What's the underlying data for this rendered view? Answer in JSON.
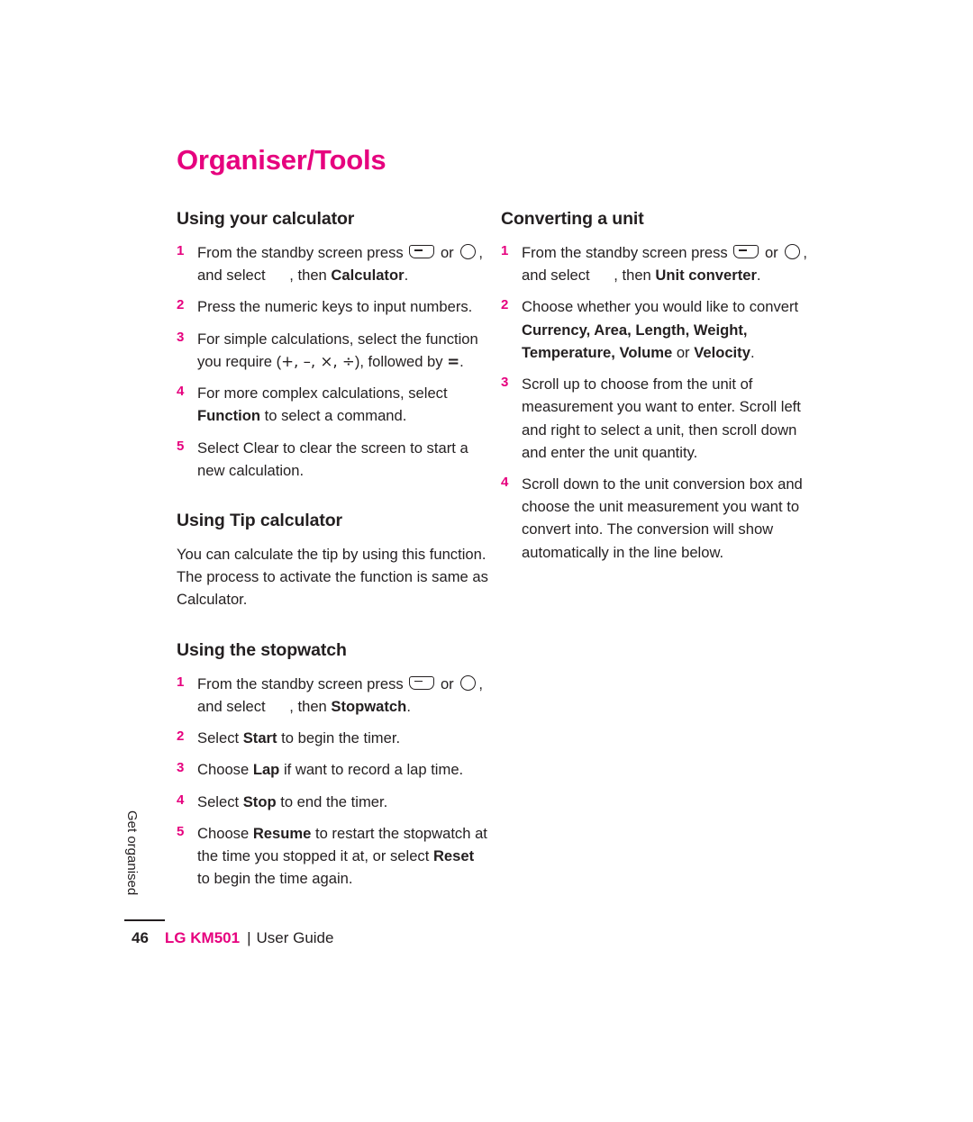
{
  "document": {
    "title": "Organiser/Tools",
    "side_tab": "Get organised",
    "footer": {
      "page_number": "46",
      "brand": "LG KM501",
      "separator": "|",
      "guide_label": "User Guide"
    }
  },
  "left_column": {
    "sections": [
      {
        "heading": "Using your calculator",
        "steps": [
          {
            "num": "1",
            "parts": [
              {
                "t": "text",
                "v": "From the standby screen press "
              },
              {
                "t": "icon",
                "v": "soft-key-icon"
              },
              {
                "t": "text",
                "v": " or "
              },
              {
                "t": "icon",
                "v": "circle-key-icon"
              },
              {
                "t": "text",
                "v": ", and select "
              },
              {
                "t": "gap",
                "v": ""
              },
              {
                "t": "text",
                "v": ", then "
              },
              {
                "t": "bold",
                "v": "Calculator"
              },
              {
                "t": "text",
                "v": "."
              }
            ]
          },
          {
            "num": "2",
            "parts": [
              {
                "t": "text",
                "v": "Press the numeric keys to input numbers."
              }
            ]
          },
          {
            "num": "3",
            "parts": [
              {
                "t": "text",
                "v": "For simple calculations, select the function you require ("
              },
              {
                "t": "math",
                "v": "+, –, ×, ÷"
              },
              {
                "t": "text",
                "v": "), followed by "
              },
              {
                "t": "boldmath",
                "v": "="
              },
              {
                "t": "text",
                "v": "."
              }
            ]
          },
          {
            "num": "4",
            "parts": [
              {
                "t": "text",
                "v": "For more complex calculations, select "
              },
              {
                "t": "bold",
                "v": "Function"
              },
              {
                "t": "text",
                "v": " to select a command."
              }
            ]
          },
          {
            "num": "5",
            "parts": [
              {
                "t": "text",
                "v": "Select Clear to clear the screen to start a new calculation."
              }
            ]
          }
        ]
      },
      {
        "heading": "Using Tip calculator",
        "paragraphs": [
          "You can calculate the tip by using this function. The process to activate the function is same as Calculator."
        ]
      },
      {
        "heading": "Using the stopwatch",
        "steps": [
          {
            "num": "1",
            "parts": [
              {
                "t": "text",
                "v": "From the standby screen press "
              },
              {
                "t": "icon",
                "v": "soft-key-icon"
              },
              {
                "t": "text",
                "v": " or "
              },
              {
                "t": "icon",
                "v": "circle-key-icon"
              },
              {
                "t": "text",
                "v": ", and select "
              },
              {
                "t": "gap",
                "v": ""
              },
              {
                "t": "text",
                "v": ", then "
              },
              {
                "t": "bold",
                "v": "Stopwatch"
              },
              {
                "t": "text",
                "v": "."
              }
            ]
          },
          {
            "num": "2",
            "parts": [
              {
                "t": "text",
                "v": "Select "
              },
              {
                "t": "bold",
                "v": "Start"
              },
              {
                "t": "text",
                "v": " to begin the timer."
              }
            ]
          },
          {
            "num": "3",
            "parts": [
              {
                "t": "text",
                "v": "Choose "
              },
              {
                "t": "bold",
                "v": "Lap"
              },
              {
                "t": "text",
                "v": " if want to record a lap time."
              }
            ]
          },
          {
            "num": "4",
            "parts": [
              {
                "t": "text",
                "v": "Select "
              },
              {
                "t": "bold",
                "v": "Stop"
              },
              {
                "t": "text",
                "v": " to end the timer."
              }
            ]
          },
          {
            "num": "5",
            "parts": [
              {
                "t": "text",
                "v": "Choose "
              },
              {
                "t": "bold",
                "v": "Resume"
              },
              {
                "t": "text",
                "v": " to restart the stopwatch at the time you stopped it at, or select "
              },
              {
                "t": "bold",
                "v": "Reset"
              },
              {
                "t": "text",
                "v": " to begin the time again."
              }
            ]
          }
        ]
      }
    ]
  },
  "right_column": {
    "sections": [
      {
        "heading": "Converting a unit",
        "steps": [
          {
            "num": "1",
            "parts": [
              {
                "t": "text",
                "v": "From the standby screen press "
              },
              {
                "t": "icon",
                "v": "soft-key-icon"
              },
              {
                "t": "text",
                "v": " or "
              },
              {
                "t": "icon",
                "v": "circle-key-icon"
              },
              {
                "t": "text",
                "v": ", and select "
              },
              {
                "t": "gap",
                "v": ""
              },
              {
                "t": "text",
                "v": ", then "
              },
              {
                "t": "bold",
                "v": "Unit converter"
              },
              {
                "t": "text",
                "v": "."
              }
            ]
          },
          {
            "num": "2",
            "parts": [
              {
                "t": "text",
                "v": "Choose whether you would like to convert "
              },
              {
                "t": "bold",
                "v": "Currency, Area, Length, Weight, Temperature, Volume"
              },
              {
                "t": "text",
                "v": " or "
              },
              {
                "t": "bold",
                "v": "Velocity"
              },
              {
                "t": "text",
                "v": "."
              }
            ]
          },
          {
            "num": "3",
            "parts": [
              {
                "t": "text",
                "v": "Scroll up to choose from the unit of measurement you want to enter. Scroll left and right to select a unit, then scroll down and enter the unit quantity."
              }
            ]
          },
          {
            "num": "4",
            "parts": [
              {
                "t": "text",
                "v": "Scroll down to the unit conversion box and choose the unit measurement you want to convert into. The conversion will show automatically in the line below."
              }
            ]
          }
        ]
      }
    ]
  }
}
